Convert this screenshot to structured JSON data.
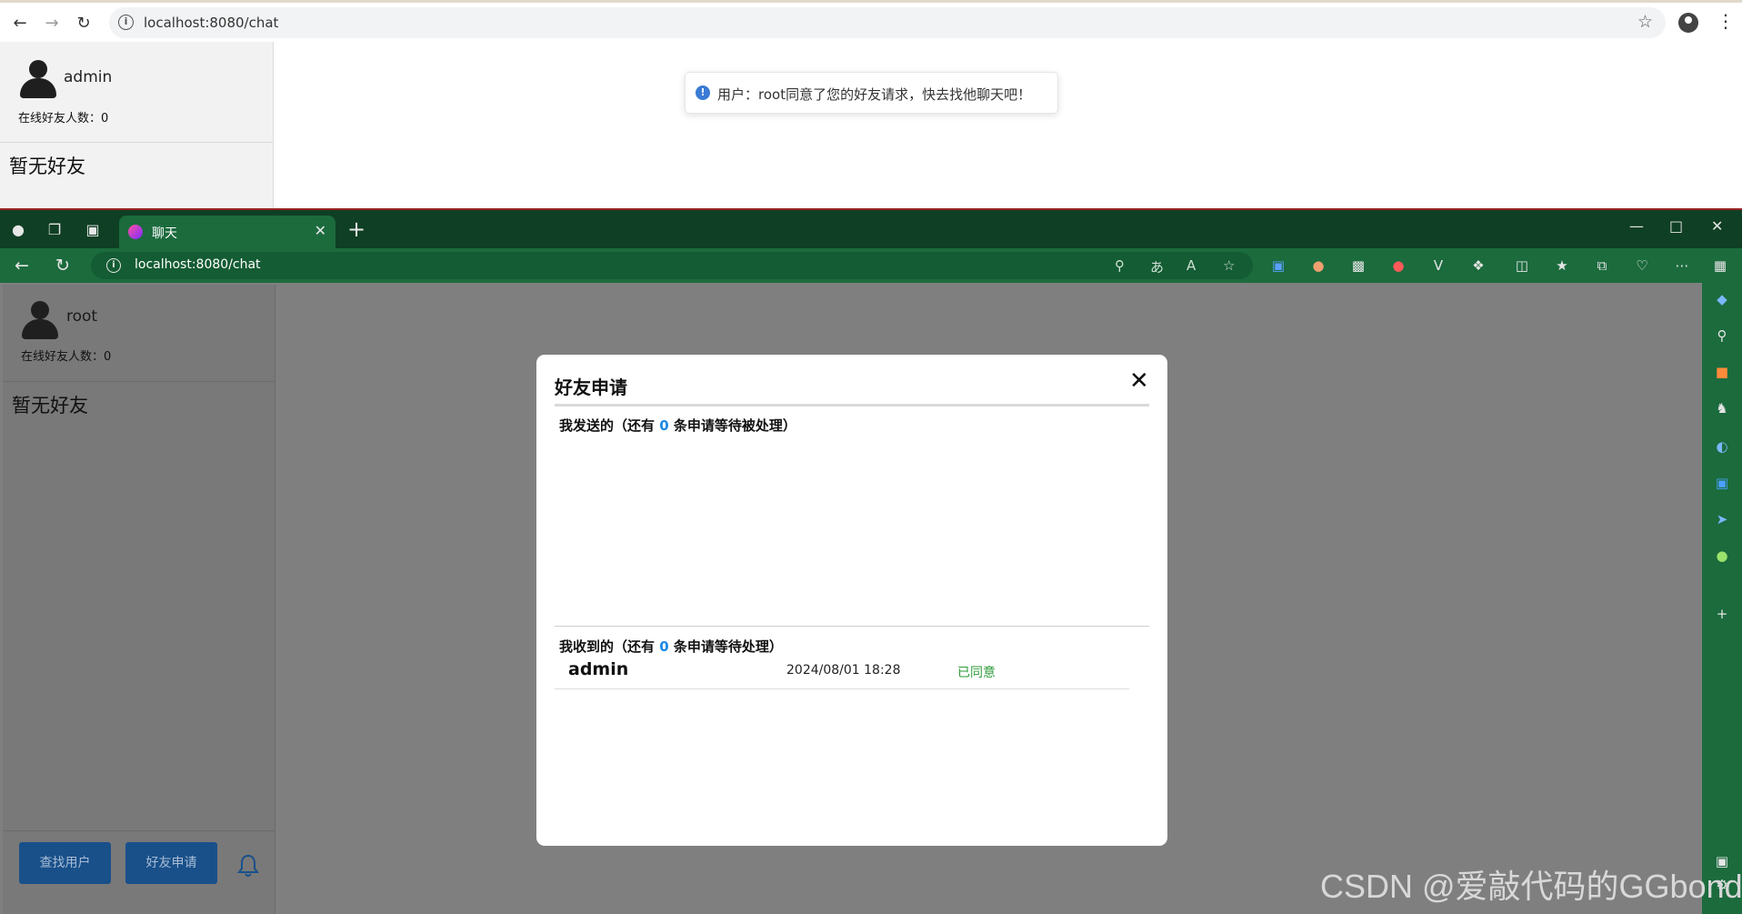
{
  "top_browser": {
    "url": "localhost:8080/chat"
  },
  "top_app": {
    "username": "admin",
    "online_label": "在线好友人数：",
    "online_count": "0",
    "no_friends": "暂无好友",
    "toast_text": "用户：root同意了您的好友请求，快去找他聊天吧！"
  },
  "edge_browser": {
    "tab_title": "聊天",
    "url": "localhost:8080/chat"
  },
  "bottom_app": {
    "username": "root",
    "online_label": "在线好友人数：",
    "online_count": "0",
    "no_friends": "暂无好友",
    "search_user_button": "查找用户",
    "friend_request_button": "好友申请"
  },
  "modal": {
    "title": "好友申请",
    "close_glyph": "✕",
    "sent_prefix": "我发送的（还有 ",
    "sent_count": "0",
    "sent_suffix": " 条申请等待被处理）",
    "received_prefix": "我收到的（还有 ",
    "received_count": "0",
    "received_suffix": " 条申请等待处理）",
    "requests": [
      {
        "name": "admin",
        "time": "2024/08/01 18:28",
        "status": "已同意"
      }
    ]
  },
  "watermark": "CSDN @爱敲代码的GGbond",
  "colors": {
    "edge_frame": "#0f3f24",
    "edge_toolbar": "#1b6b3d",
    "button_blue": "#19508a",
    "count_blue": "#1e88e5",
    "status_green": "#2e9b3a"
  }
}
